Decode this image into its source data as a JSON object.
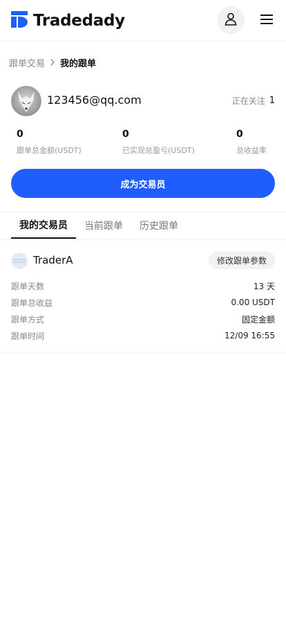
{
  "header": {
    "brand": "Tradedady",
    "colors": {
      "brand_blue": "#1f5efb"
    },
    "user_icon": "user-icon",
    "menu_icon": "hamburger-menu-icon"
  },
  "breadcrumb": {
    "parent": "跟单交易",
    "current": "我的跟单"
  },
  "profile": {
    "email": "123456@qq.com",
    "follow_label": "正在关注",
    "follow_count": "1"
  },
  "stats": [
    {
      "value": "0",
      "label": "跟单总金额(USDT)"
    },
    {
      "value": "0",
      "label": "已实现总盈亏(USDT)"
    },
    {
      "value": "0",
      "label": "总收益率"
    }
  ],
  "become_trader_label": "成为交易员",
  "tabs": [
    {
      "label": "我的交易员",
      "active": true
    },
    {
      "label": "当前跟单",
      "active": false
    },
    {
      "label": "历史跟单",
      "active": false
    }
  ],
  "trader": {
    "name": "TraderA",
    "edit_label": "修改跟单参数",
    "details": [
      {
        "label": "跟单天数",
        "value": "13 天"
      },
      {
        "label": "跟单总收益",
        "value": "0.00 USDT"
      },
      {
        "label": "跟单方式",
        "value": "固定金额"
      },
      {
        "label": "跟单时间",
        "value": "12/09 16:55"
      }
    ]
  }
}
